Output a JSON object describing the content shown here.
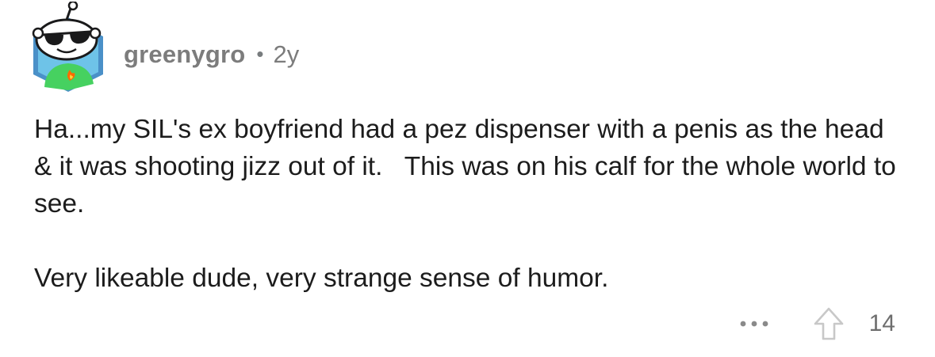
{
  "comment": {
    "author": "greenygro",
    "separator": "•",
    "age": "2y",
    "paragraphs": [
      "Ha...my SIL's ex boyfriend had a pez dispenser with a penis as the head & it was shooting jizz out of it.   This was on his calf for the whole world to see.",
      "Very likeable dude, very strange sense of humor."
    ],
    "score": "14"
  },
  "icons": {
    "avatar": "snoo-avatar-sunglasses",
    "more": "more-options-icon",
    "upvote": "upvote-arrow-icon"
  },
  "colors": {
    "avatar_bg": "#4a90c8",
    "avatar_inner": "#6ec3e8",
    "shirt": "#46d160",
    "meta_text": "#7c7c7c",
    "body_text": "#1c1c1c"
  }
}
